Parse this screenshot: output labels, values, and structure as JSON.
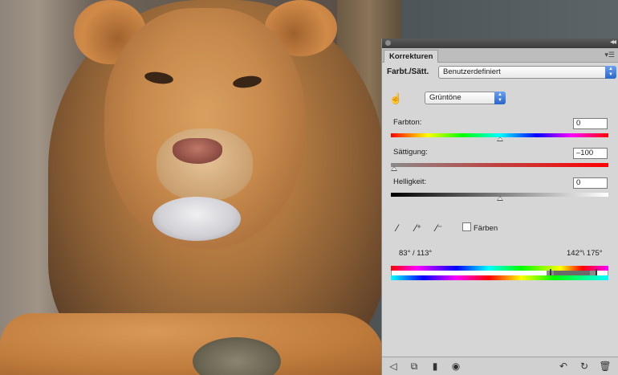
{
  "panel": {
    "tab_label": "Korrekturen",
    "tab_menu_icon": "panel-menu-icon",
    "collapse_icon": "double-chevron-right-icon",
    "preset": {
      "label": "Farbt./Sätt.",
      "value": "Benutzerdefiniert"
    },
    "range": {
      "value": "Grüntöne"
    },
    "sliders": {
      "hue": {
        "label": "Farbton:",
        "value": "0",
        "level": 0.5
      },
      "saturation": {
        "label": "Sättigung:",
        "value": "–100",
        "level": 0.0
      },
      "lightness": {
        "label": "Helligkeit:",
        "value": "0",
        "level": 0.5
      }
    },
    "colorize": {
      "label": "Färben",
      "checked": false
    },
    "degrees": {
      "left": "83° / 113°",
      "right": "142°\\ 175°"
    },
    "icons": {
      "target_adjust": "hand-target-icon",
      "eyedropper": "eyedropper-icon",
      "eyedropper_plus": "eyedropper-plus-icon",
      "eyedropper_minus": "eyedropper-minus-icon",
      "back": "back-arrow-icon",
      "clip_layer": "clip-to-layer-icon",
      "visibility": "eye-icon",
      "previous_state": "previous-state-icon",
      "reset": "reset-icon",
      "trash": "trash-icon",
      "mask": "layer-mask-icon"
    }
  }
}
